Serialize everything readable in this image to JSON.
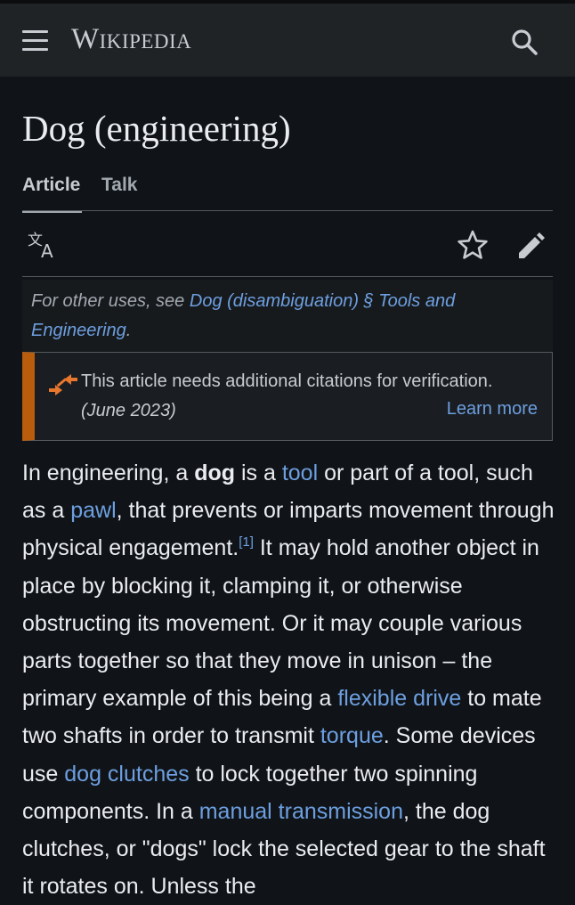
{
  "header": {
    "menu_icon": "hamburger-menu-icon",
    "wordmark": "Wikipedia",
    "search_icon": "search-icon"
  },
  "article": {
    "title": "Dog (engineering)"
  },
  "tabs": [
    {
      "label": "Article",
      "active": true
    },
    {
      "label": "Talk",
      "active": false
    }
  ],
  "toolbar": {
    "language_icon": "language-icon",
    "watch_icon": "star-icon",
    "edit_icon": "pencil-icon"
  },
  "hatnote": {
    "prefix": "For other uses, see ",
    "link": "Dog (disambiguation) § Tools and Engineering",
    "suffix": "."
  },
  "ambox": {
    "text": "This article needs additional citations for verification.",
    "date": "(June 2023)",
    "learn_more": "Learn more",
    "accent_color": "#b75d0b"
  },
  "body": {
    "t1": "In engineering, a ",
    "bold1": "dog",
    "t2": " is a ",
    "link_tool": "tool",
    "t3": " or part of a tool, such as a ",
    "link_pawl": "pawl",
    "t4": ", that prevents or imparts movement through physical engagement.",
    "ref1": "[1]",
    "t5": " It may hold another object in place by blocking it, clamping it, or otherwise obstructing its movement. Or it may couple various parts together so that they move in unison – the primary example of this being a ",
    "link_flexible_drive": "flexible drive",
    "t6": " to mate two shafts in order to transmit ",
    "link_torque": "torque",
    "t7": ". Some devices use ",
    "link_dog_clutches": "dog clutches",
    "t8": " to lock together two spinning components. In a ",
    "link_manual_transmission": "manual transmission",
    "t9": ", the dog clutches, or \"dogs\" lock the selected gear to the shaft it rotates on. Unless the"
  },
  "colors": {
    "background": "#101418",
    "header_bg": "#1f2326",
    "link": "#6d9fe0",
    "text": "#eaecf0"
  }
}
